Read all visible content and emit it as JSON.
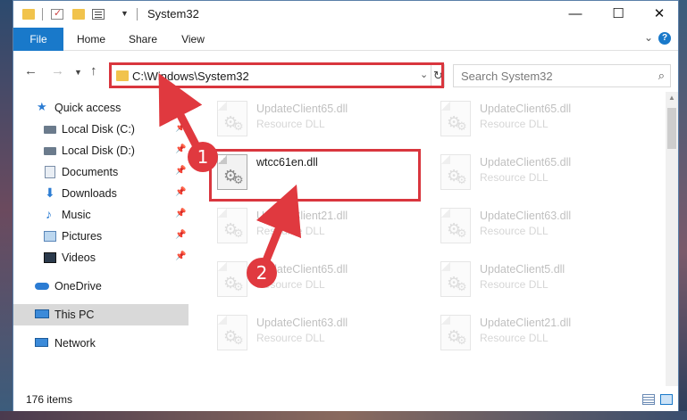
{
  "window": {
    "title": "System32",
    "controls": {
      "minimize": "—",
      "maximize": "☐",
      "close": "✕"
    }
  },
  "ribbon": {
    "tabs": [
      "File",
      "Home",
      "Share",
      "View"
    ]
  },
  "address": {
    "path": "C:\\Windows\\System32",
    "search_placeholder": "Search System32"
  },
  "sidebar": {
    "items": [
      {
        "label": "Quick access",
        "icon": "star-icon",
        "pinned": false
      },
      {
        "label": "Local Disk (C:)",
        "icon": "drive-icon",
        "pinned": true
      },
      {
        "label": "Local Disk (D:)",
        "icon": "drive-icon",
        "pinned": true
      },
      {
        "label": "Documents",
        "icon": "documents-icon",
        "pinned": true
      },
      {
        "label": "Downloads",
        "icon": "download-icon",
        "pinned": true
      },
      {
        "label": "Music",
        "icon": "music-icon",
        "pinned": true
      },
      {
        "label": "Pictures",
        "icon": "pictures-icon",
        "pinned": true
      },
      {
        "label": "Videos",
        "icon": "videos-icon",
        "pinned": true
      },
      {
        "label": "OneDrive",
        "icon": "cloud-icon",
        "pinned": false
      },
      {
        "label": "This PC",
        "icon": "computer-icon",
        "pinned": false,
        "selected": true
      },
      {
        "label": "Network",
        "icon": "network-icon",
        "pinned": false
      }
    ]
  },
  "files": {
    "highlighted": {
      "name": "wtcc61en.dll",
      "type": ""
    },
    "left_column": [
      {
        "name": "UpdateClient65.dll",
        "type": "Resource DLL"
      },
      {
        "name": "UpdateClient21.dll",
        "type": "Resource DLL"
      },
      {
        "name": "UpdateClient65.dll",
        "type": "Resource DLL"
      },
      {
        "name": "UpdateClient63.dll",
        "type": "Resource DLL"
      }
    ],
    "right_column": [
      {
        "name": "UpdateClient65.dll",
        "type": "Resource DLL"
      },
      {
        "name": "UpdateClient65.dll",
        "type": "Resource DLL"
      },
      {
        "name": "UpdateClient63.dll",
        "type": "Resource DLL"
      },
      {
        "name": "UpdateClient5.dll",
        "type": "Resource DLL"
      },
      {
        "name": "UpdateClient21.dll",
        "type": "Resource DLL"
      }
    ]
  },
  "status": {
    "item_count": "176 items"
  },
  "annotations": {
    "step1": "1",
    "step2": "2"
  },
  "colors": {
    "accent": "#1979ca",
    "highlight": "#d9363e"
  }
}
